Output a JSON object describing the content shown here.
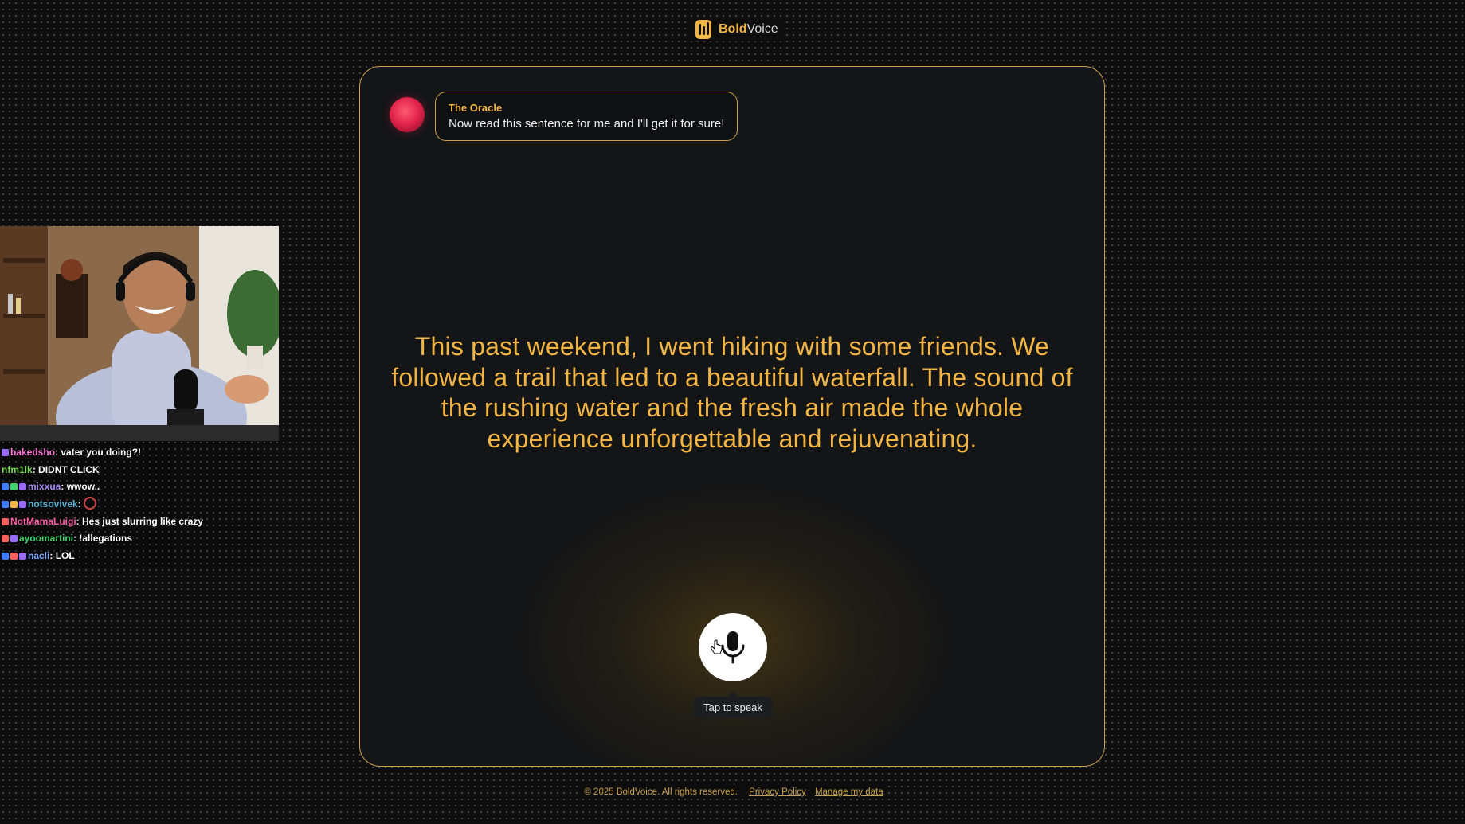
{
  "brand": {
    "name_bold": "Bold",
    "name_regular": "Voice"
  },
  "oracle": {
    "sender": "The Oracle",
    "message": "Now read this sentence for me and I'll get it for sure!"
  },
  "sentence": "This past weekend, I went hiking with some friends. We followed a trail that led to a beautiful waterfall. The sound of the rushing water and the fresh air made the whole experience unforgettable and rejuvenating.",
  "mic": {
    "icon": "microphone-icon",
    "tooltip": "Tap to speak"
  },
  "footer": {
    "copyright": "© 2025 BoldVoice. All rights reserved.",
    "privacy": "Privacy Policy",
    "manage": "Manage my data"
  },
  "colors": {
    "accent": "#f2b544",
    "border": "#caa04a",
    "background": "#0d0d0d",
    "card": "#141517"
  },
  "stream_chat": [
    {
      "user": "bakedsho",
      "user_color": "#ff7ad9",
      "message": "vater you doing?!"
    },
    {
      "user": "nfm1lk",
      "user_color": "#7ad957",
      "message": "DIDNT CLICK"
    },
    {
      "user": "mixxua",
      "user_color": "#a78bfa",
      "message": "wwow.."
    },
    {
      "user": "notsovivek",
      "user_color": "#5ab4d6",
      "message": ""
    },
    {
      "user": "NotMamaLuigi",
      "user_color": "#ff5fa2",
      "message": "Hes just slurring like crazy"
    },
    {
      "user": "ayoomartini",
      "user_color": "#3fd46b",
      "message": "!allegations"
    },
    {
      "user": "nacli",
      "user_color": "#7aa7ff",
      "message": "LOL"
    }
  ]
}
